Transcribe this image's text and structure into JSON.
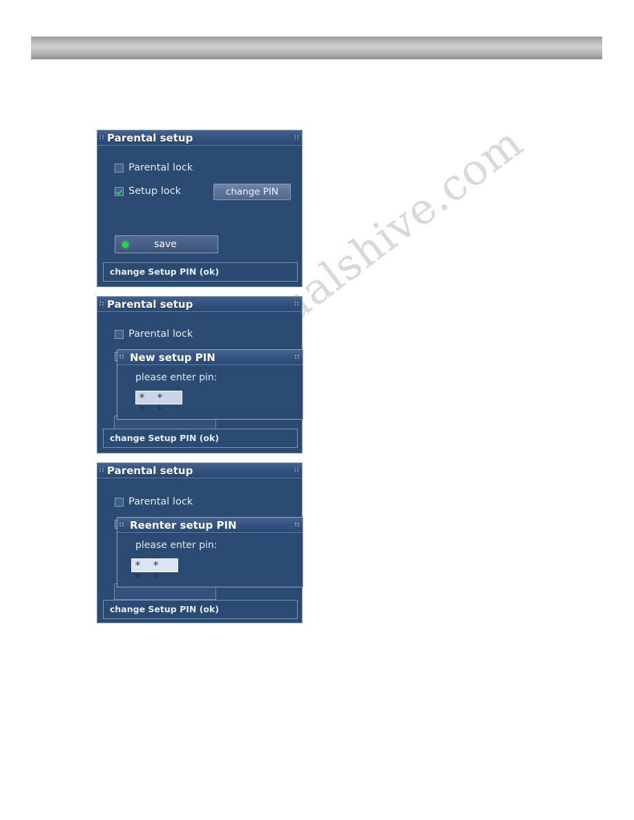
{
  "page": {
    "watermark_text": "manualshive.com"
  },
  "dialogs": [
    {
      "title": "Parental setup",
      "parental_lock_label": "Parental lock",
      "parental_lock_checked": false,
      "setup_lock_label": "Setup lock",
      "setup_lock_checked": true,
      "change_pin_label": "change PIN",
      "save_label": "save",
      "status": "change Setup PIN (ok)"
    },
    {
      "title": "Parental setup",
      "parental_lock_label": "Parental lock",
      "parental_lock_checked": false,
      "sub_title": "New setup PIN",
      "sub_prompt": "please enter pin:",
      "pin_value": "* * * *",
      "status": "change Setup PIN (ok)"
    },
    {
      "title": "Parental setup",
      "parental_lock_label": "Parental lock",
      "parental_lock_checked": false,
      "sub_title": "Reenter setup PIN",
      "sub_prompt": "please enter pin:",
      "pin_value": "* * * *",
      "status": "change Setup PIN (ok)"
    }
  ]
}
